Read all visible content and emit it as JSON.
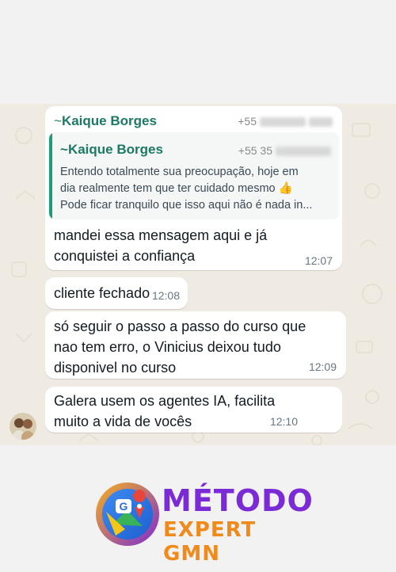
{
  "conversation": {
    "forwarded_message": {
      "sender": "Kaique Borges",
      "phone_prefix": "+55",
      "quoted": {
        "sender": "Kaique Borges",
        "phone_prefix": "+55 35",
        "lines": [
          "Entendo totalmente sua preocupação, hoje em",
          "dia realmente tem que ter cuidado mesmo 👍",
          "Pode ficar tranquilo que isso aqui não é nada in..."
        ]
      },
      "text_lines": [
        "mandei essa mensagem aqui e já",
        "conquistei a confiança"
      ],
      "time": "12:07"
    },
    "messages": [
      {
        "lines": [
          "cliente fechado"
        ],
        "time": "12:08"
      },
      {
        "lines": [
          "só seguir o passo a passo do curso que",
          "nao tem erro, o Vinicius deixou tudo",
          "disponivel no curso"
        ],
        "time": "12:09"
      },
      {
        "lines": [
          "Galera usem os agentes IA, facilita",
          "muito a vida de vocês"
        ],
        "time": "12:10"
      }
    ]
  },
  "brand": {
    "title": "MÉTODO",
    "subtitle": "EXPERT GMN",
    "icon_letter": "G",
    "colors": {
      "title": "#7b2bd6",
      "subtitle": "#f08a1c"
    }
  },
  "colors": {
    "sender": "#1b7a63",
    "chat_bg": "#efeae2",
    "bubble": "#ffffff"
  }
}
